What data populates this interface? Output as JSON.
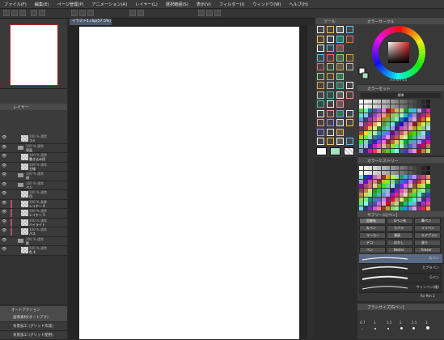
{
  "menu": {
    "items": [
      "ファイル(F)",
      "編集(E)",
      "ページ管理(P)",
      "アニメーション(A)",
      "レイヤー(L)",
      "選択範囲(S)",
      "表示(V)",
      "フィルター(I)",
      "ウィンドウ(W)",
      "ヘルプ(H)"
    ]
  },
  "canvas": {
    "tab_label": "イラスト1.clip(57.5%) ×"
  },
  "layers": {
    "header": "レイヤー",
    "rows": [
      {
        "mode": "100 % 通常",
        "name": "ゴミ",
        "type": "layer"
      },
      {
        "mode": "100 % 通常",
        "name": "背面",
        "type": "folder"
      },
      {
        "mode": "100 % 通常",
        "name": "書き込み用",
        "type": "layer"
      },
      {
        "mode": "100 % 通常",
        "name": "主線",
        "type": "layer"
      },
      {
        "mode": "100 % 通常",
        "name": "顔",
        "type": "folder"
      },
      {
        "mode": "100 % 通常",
        "name": "ペン",
        "type": "folder"
      },
      {
        "mode": "100 % 通常",
        "name": "目",
        "type": "layer"
      },
      {
        "mode": "100 % 乗算",
        "name": "レイヤー 4",
        "type": "layer"
      },
      {
        "mode": "100 % 通常",
        "name": "レイヤー 5",
        "type": "layer"
      },
      {
        "mode": "100 % 通常",
        "name": "ハイライト",
        "type": "layer"
      },
      {
        "mode": "100 % 通常",
        "name": "パス",
        "type": "layer"
      },
      {
        "mode": "100 % 通常",
        "name": "影",
        "type": "folder"
      },
      {
        "mode": "100 % 通常",
        "name": "色 4",
        "type": "layer"
      }
    ]
  },
  "auto_action": {
    "header": "オートアクション",
    "set_name": "画像素材(オートアク)",
    "items": [
      "背景加工 (グリッド作成)",
      "背景加工 (グリッド使用)"
    ]
  },
  "tool_palette": {
    "header": "ツール"
  },
  "color_wheel": {
    "header": "カラーサークル",
    "readout": "H:0 S:0 V:0"
  },
  "color_set": {
    "header": "カラーセット",
    "set_name": "標準"
  },
  "color_history": {
    "header": "カラーヒストリー"
  },
  "sub_tool": {
    "header": "サブツール[ペン]",
    "buttons": [
      "鉛筆系",
      "Gペン系",
      "筆ペン",
      "丸ペン",
      "カブラ",
      "ミリペン",
      "マーカー",
      "漫画",
      "エアブラシ",
      "デコ",
      "ぼかし",
      "塗り",
      "ペン",
      "Bezier",
      "Eraser"
    ],
    "brushes": [
      "丸ペン",
      "カブラペン",
      "Gペン",
      "サインペン(細)"
    ],
    "footer": "Ro-Pen 2"
  },
  "brush_size": {
    "header": "ブラシサイズ[Gペン]",
    "sizes": [
      "0.7",
      "1",
      "1.5",
      "2",
      "2.5",
      "3"
    ]
  },
  "colors": {
    "main": "#ffffff",
    "sub": "#a8e0c0",
    "accent_tab": "#4d5a6b",
    "selected_row": "#5a6a85"
  }
}
